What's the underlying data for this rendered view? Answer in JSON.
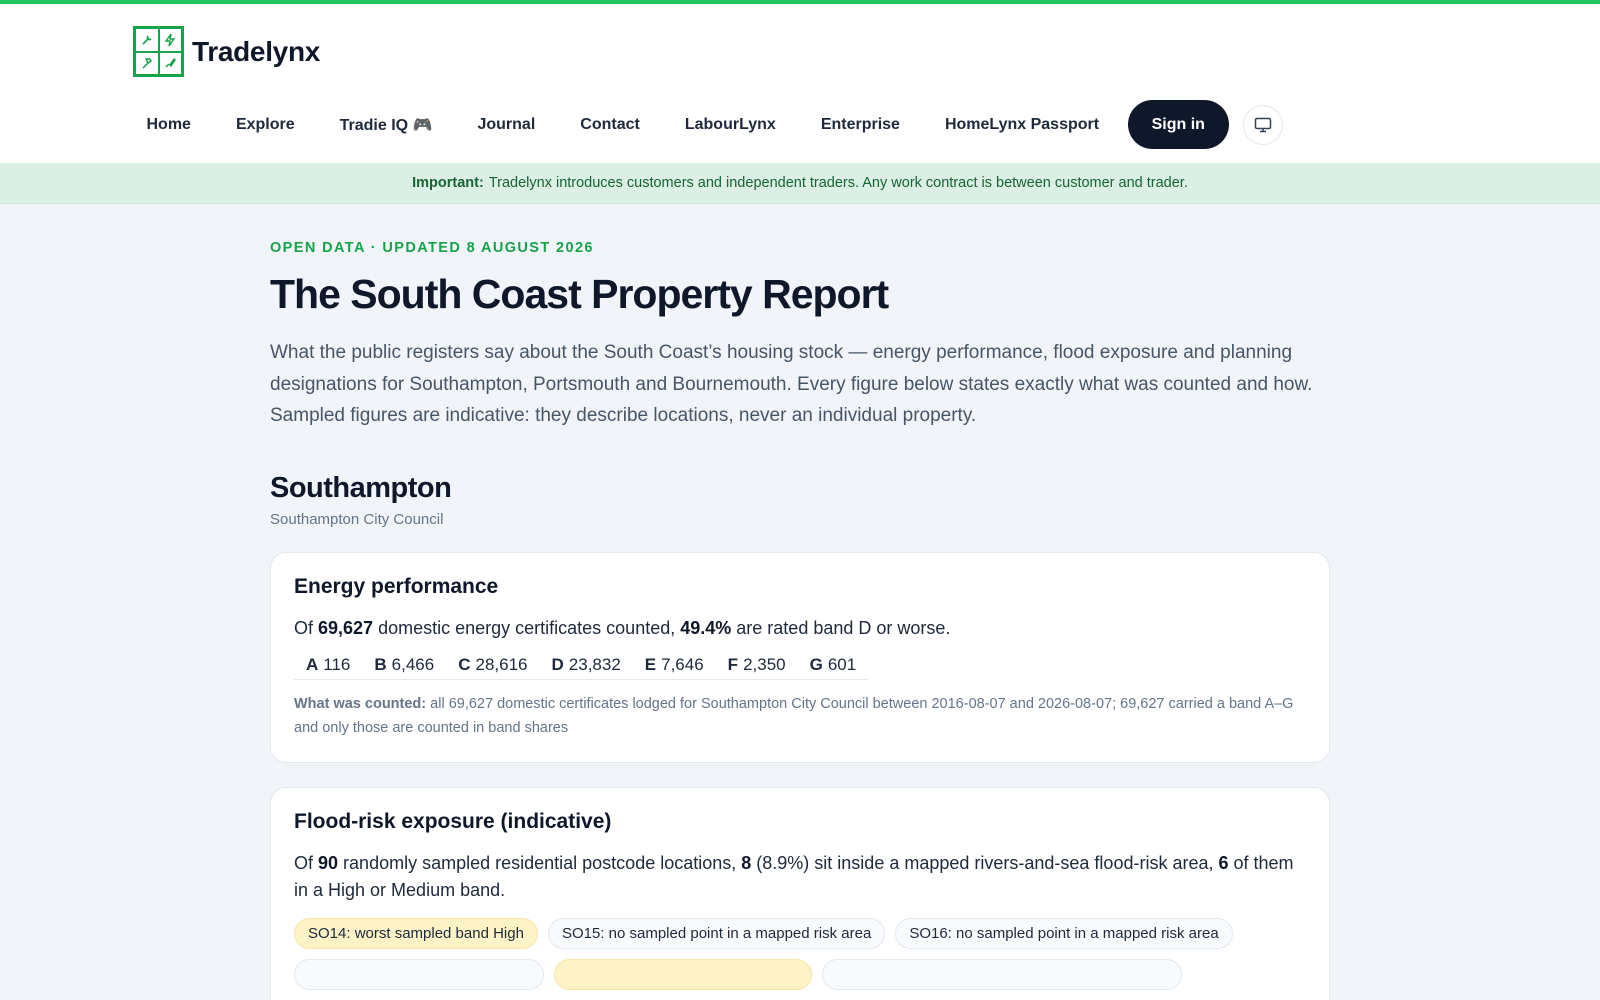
{
  "brand": {
    "name": "Tradelynx",
    "accent": "#22c55e",
    "dark": "#0f172a"
  },
  "nav": {
    "items": [
      {
        "label": "Home"
      },
      {
        "label": "Explore"
      },
      {
        "label": "Tradie IQ 🎮"
      },
      {
        "label": "Journal"
      },
      {
        "label": "Contact"
      },
      {
        "label": "LabourLynx"
      },
      {
        "label": "Enterprise"
      },
      {
        "label": "HomeLynx Passport"
      }
    ],
    "signin_label": "Sign in",
    "theme_icon": "monitor-icon"
  },
  "notice": {
    "label": "Important:",
    "text": "Tradelynx introduces customers and independent traders. Any work contract is between customer and trader."
  },
  "report": {
    "eyebrow": "OPEN DATA · UPDATED 8 AUGUST 2026",
    "title": "The South Coast Property Report",
    "lede": "What the public registers say about the South Coast’s housing stock — energy performance, flood exposure and planning designations for Southampton, Portsmouth and Bournemouth. Every figure below states exactly what was counted and how. Sampled figures are indicative: they describe locations, never an individual property."
  },
  "area": {
    "name": "Southampton",
    "council": "Southampton City Council"
  },
  "energy": {
    "title": "Energy performance",
    "s1": "Of ",
    "count": "69,627",
    "s2": " domestic energy certificates counted, ",
    "pct": "49.4%",
    "s3": " are rated band D or worse.",
    "bands": [
      {
        "band": "A",
        "value": "116"
      },
      {
        "band": "B",
        "value": "6,466"
      },
      {
        "band": "C",
        "value": "28,616"
      },
      {
        "band": "D",
        "value": "23,832"
      },
      {
        "band": "E",
        "value": "7,646"
      },
      {
        "band": "F",
        "value": "2,350"
      },
      {
        "band": "G",
        "value": "601"
      }
    ],
    "counted_label": "What was counted:",
    "counted_text": " all 69,627 domestic certificates lodged for Southampton City Council between 2016-08-07 and 2026-08-07; 69,627 carried a band A–G and only those are counted in band shares"
  },
  "flood": {
    "title": "Flood-risk exposure (indicative)",
    "s1": "Of ",
    "sampled": "90",
    "s2": " randomly sampled residential postcode locations, ",
    "inside": "8",
    "s3": " (8.9%) sit inside a mapped rivers-and-sea flood-risk area, ",
    "high": "6",
    "s4": " of them in a High or Medium band.",
    "pills": [
      {
        "text": "SO14: worst sampled band High",
        "warn": true
      },
      {
        "text": "SO15: no sampled point in a mapped risk area",
        "warn": false
      },
      {
        "text": "SO16: no sampled point in a mapped risk area",
        "warn": false
      }
    ]
  }
}
